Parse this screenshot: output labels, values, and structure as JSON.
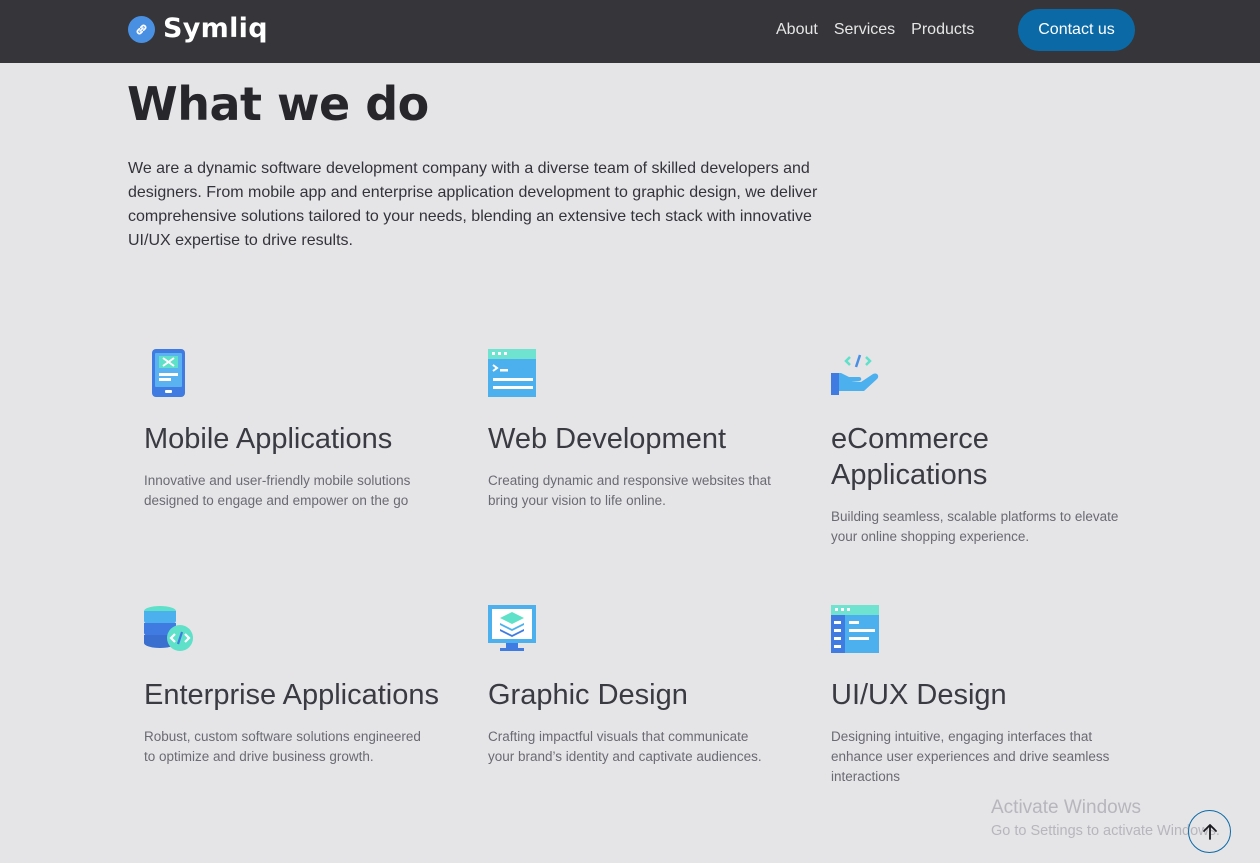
{
  "brand": {
    "name": "Symliq",
    "icon": "link-icon"
  },
  "nav": {
    "links": [
      "About",
      "Services",
      "Products"
    ],
    "contact_label": "Contact us"
  },
  "hero": {
    "title": "What we do",
    "intro": "We are a dynamic software development company with a diverse team of skilled developers and designers. From mobile app and enterprise application development to graphic design, we deliver comprehensive solutions tailored to your needs, blending an extensive tech stack with innovative UI/UX expertise to drive results."
  },
  "services": [
    {
      "icon": "mobile-app-icon",
      "title": "Mobile Applications",
      "desc": "Innovative and user-friendly mobile solutions designed to engage and empower on the go"
    },
    {
      "icon": "web-window-icon",
      "title": "Web Development",
      "desc": "Creating dynamic and responsive websites that bring your vision to life online."
    },
    {
      "icon": "hand-code-icon",
      "title": "eCommerce Applications",
      "desc": "Building seamless, scalable platforms to elevate your online shopping experience."
    },
    {
      "icon": "database-code-icon",
      "title": "Enterprise Applications",
      "desc": "Robust, custom software solutions engineered to optimize and drive business growth."
    },
    {
      "icon": "monitor-layers-icon",
      "title": "Graphic Design",
      "desc": "Crafting impactful visuals that communicate your brand’s identity and captivate audiences."
    },
    {
      "icon": "ui-layout-icon",
      "title": "UI/UX Design",
      "desc": "Designing intuitive, engaging interfaces that enhance user experiences and drive seamless interactions"
    }
  ],
  "watermark": {
    "title": "Activate Windows",
    "subtitle": "Go to Settings to activate Windows."
  },
  "scroll_top": {
    "icon": "arrow-up-icon"
  },
  "colors": {
    "topbar": "#35353a",
    "background": "#e5e5e8",
    "accent": "#0b6aa6",
    "icon_blue": "#4a90e2",
    "icon_teal": "#5fe0c8"
  }
}
